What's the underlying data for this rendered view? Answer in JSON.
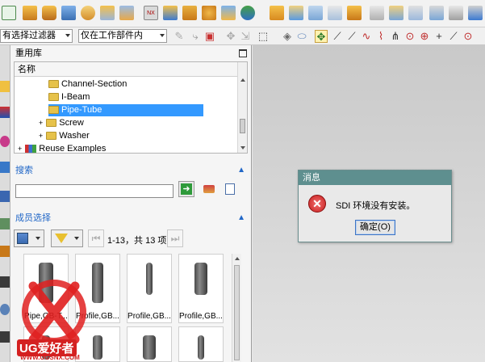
{
  "toolbar2": {
    "filter_combo": "有选择过滤器",
    "scope_combo": "仅在工作部件内"
  },
  "reuse_library": {
    "title": "重用库",
    "column_header": "名称",
    "tree": [
      {
        "label": "Channel-Section",
        "selected": false
      },
      {
        "label": "I-Beam",
        "selected": false
      },
      {
        "label": "Pipe-Tube",
        "selected": true
      },
      {
        "label": "Screw",
        "selected": false
      },
      {
        "label": "Washer",
        "selected": false
      },
      {
        "label": "Reuse Examples",
        "selected": false
      }
    ]
  },
  "search": {
    "title": "搜索",
    "value": ""
  },
  "members": {
    "title": "成员选择",
    "page_info": "1-13，共 13 项",
    "items": [
      {
        "label": "Pipe,GB-T..."
      },
      {
        "label": "Profile,GB..."
      },
      {
        "label": "Profile,GB..."
      },
      {
        "label": "Profile,GB..."
      }
    ]
  },
  "dialog": {
    "title": "消息",
    "message": "SDI 环境没有安装。",
    "ok_label": "确定(O)"
  },
  "watermark": {
    "brand": "UG爱好者",
    "url": "WWW.UGSNX.COM"
  },
  "colors": {
    "selection": "#3399ff",
    "dialog_title": "#5e8f8f",
    "section_title": "#2167c7",
    "error_red": "#d22b2b"
  }
}
